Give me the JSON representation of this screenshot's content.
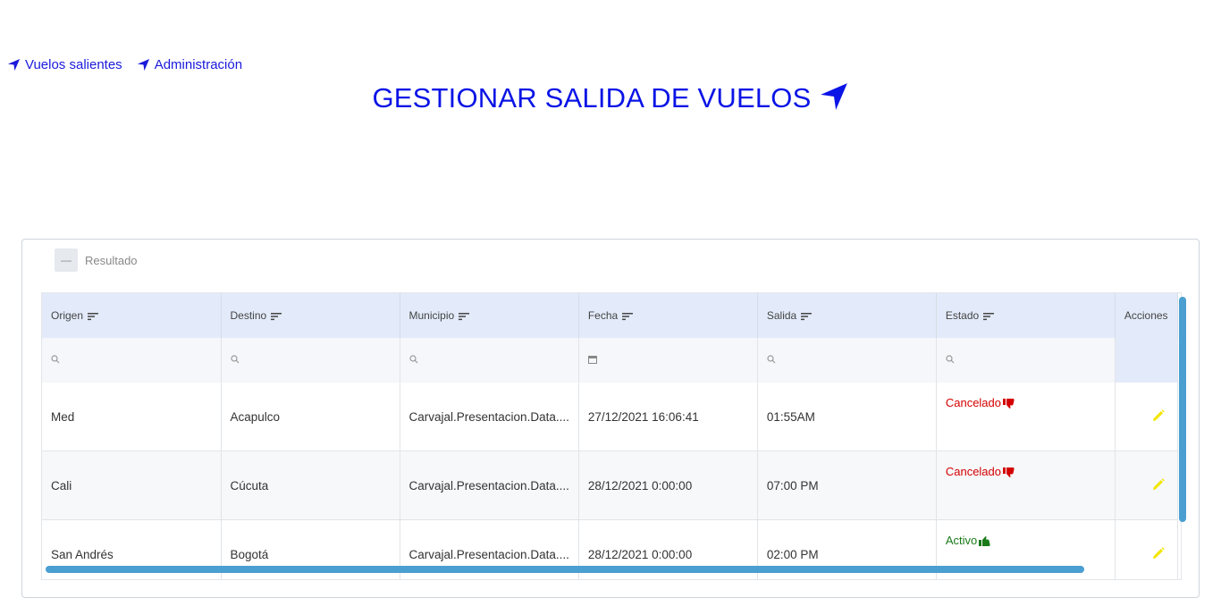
{
  "nav": {
    "links": [
      {
        "label": "Vuelos salientes",
        "icon": "location-arrow-icon"
      },
      {
        "label": "Administración",
        "icon": "location-arrow-icon"
      }
    ]
  },
  "page": {
    "title": "GESTIONAR SALIDA DE VUELOS",
    "title_icon": "location-arrow-icon"
  },
  "panel": {
    "collapse_label": "—",
    "title": "Resultado"
  },
  "grid": {
    "columns": [
      "Origen",
      "Destino",
      "Municipio",
      "Fecha",
      "Salida",
      "Estado",
      "Acciones"
    ],
    "filter_icons": [
      "search-icon",
      "search-icon",
      "search-icon",
      "calendar-icon",
      "search-icon",
      "search-icon"
    ],
    "rows": [
      {
        "origen": "Med",
        "destino": "Acapulco",
        "municipio": "Carvajal.Presentacion.Data....",
        "fecha": "27/12/2021 16:06:41",
        "salida": "01:55AM",
        "estado": "Cancelado",
        "estado_type": "cancel"
      },
      {
        "origen": "Cali",
        "destino": "Cúcuta",
        "municipio": "Carvajal.Presentacion.Data....",
        "fecha": "28/12/2021 0:00:00",
        "salida": "07:00 PM",
        "estado": "Cancelado",
        "estado_type": "cancel"
      },
      {
        "origen": "San Andrés",
        "destino": "Bogotá",
        "municipio": "Carvajal.Presentacion.Data....",
        "fecha": "28/12/2021 0:00:00",
        "salida": "02:00 PM",
        "estado": "Activo",
        "estado_type": "activo"
      }
    ]
  },
  "colors": {
    "link": "#1a1adb",
    "title": "#0a14e6",
    "header_bg": "#e3ebfa",
    "cancel": "#d40000",
    "activo": "#1a7a1a",
    "edit_icon": "#f2e600",
    "scrollbar": "#4a9fd0"
  }
}
